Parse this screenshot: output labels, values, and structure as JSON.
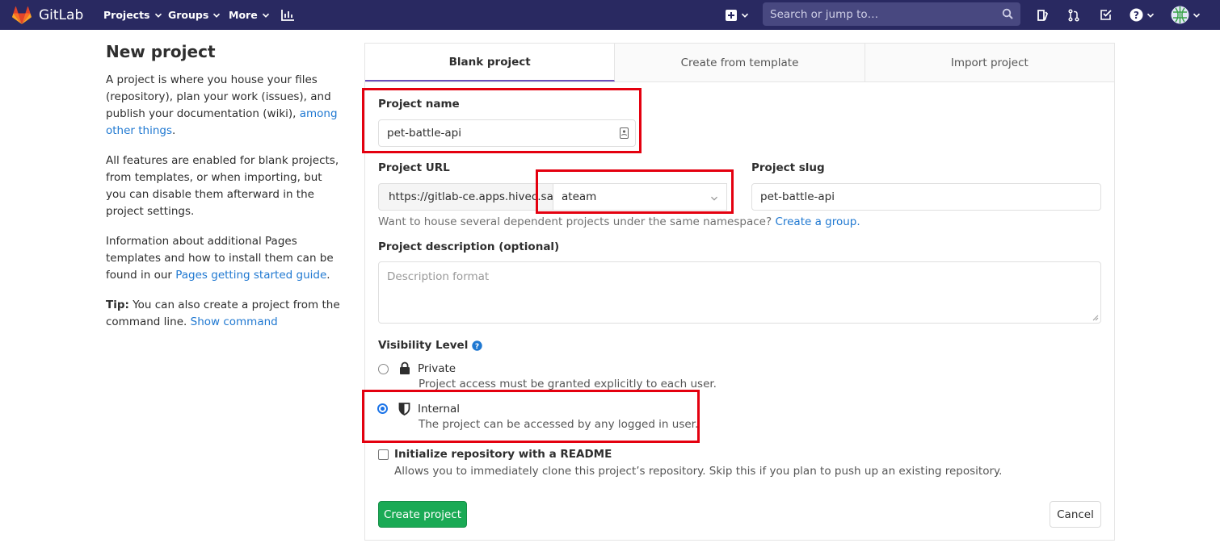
{
  "navbar": {
    "brand": "GitLab",
    "projects": "Projects",
    "groups": "Groups",
    "more": "More",
    "search_placeholder": "Search or jump to…"
  },
  "sidebar": {
    "title": "New project",
    "p1_text": "A project is where you house your files (repository), plan your work (issues), and publish your documentation (wiki),",
    "p1_link": "among other things",
    "p1_end": ".",
    "p2": "All features are enabled for blank projects, from templates, or when importing, but you can disable them afterward in the project settings.",
    "p3_text": "Information about additional Pages templates and how to install them can be found in our",
    "p3_link": "Pages getting started guide",
    "p3_end": ".",
    "tip_label": "Tip:",
    "tip_text": "You can also create a project from the command line.",
    "tip_link": "Show command"
  },
  "tabs": {
    "blank": "Blank project",
    "template": "Create from template",
    "import": "Import project"
  },
  "form": {
    "project_name_label": "Project name",
    "project_name_value": "pet-battle-api",
    "project_url_label": "Project URL",
    "project_url_prefix": "https://gitlab-ce.apps.hivec.sand",
    "namespace_value": "ateam",
    "project_slug_label": "Project slug",
    "project_slug_value": "pet-battle-api",
    "namespace_help": "Want to house several dependent projects under the same namespace?",
    "namespace_help_link": "Create a group.",
    "description_label": "Project description (optional)",
    "description_placeholder": "Description format",
    "visibility_label": "Visibility Level",
    "private_label": "Private",
    "private_desc": "Project access must be granted explicitly to each user.",
    "internal_label": "Internal",
    "internal_desc": "The project can be accessed by any logged in user.",
    "readme_label": "Initialize repository with a README",
    "readme_desc": "Allows you to immediately clone this project’s repository. Skip this if you plan to push up an existing repository.",
    "create_button": "Create project",
    "cancel_button": "Cancel"
  }
}
